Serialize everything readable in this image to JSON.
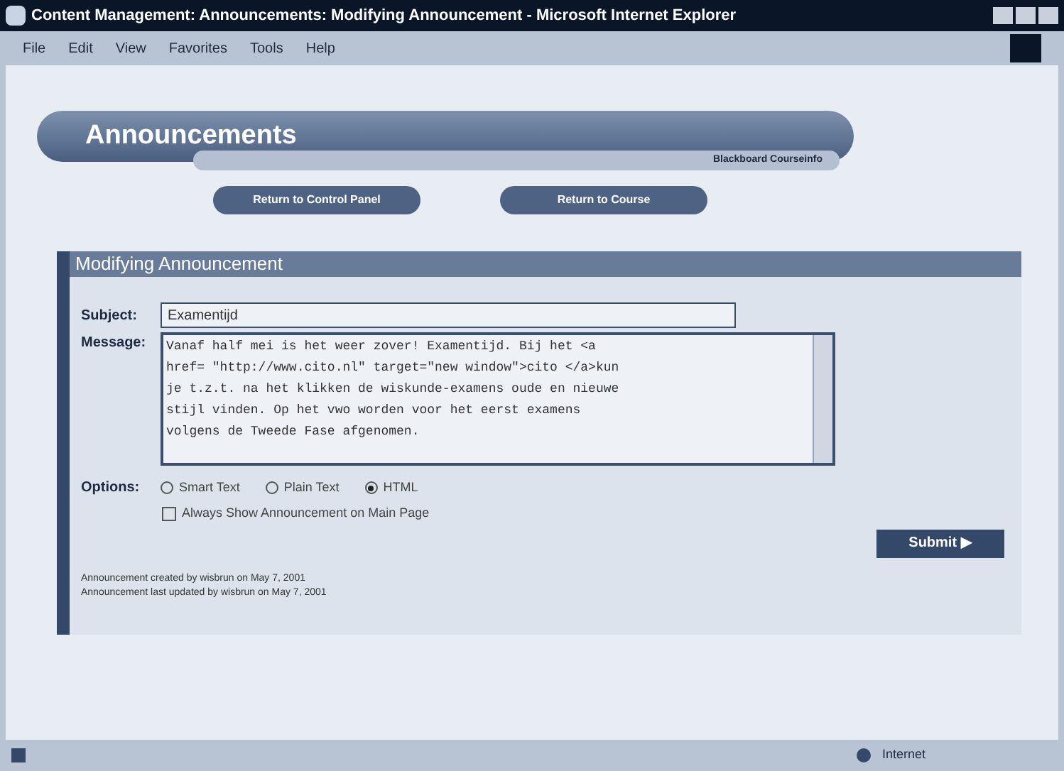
{
  "window": {
    "title": "Content Management: Announcements: Modifying Announcement - Microsoft Internet Explorer"
  },
  "menu": [
    "File",
    "Edit",
    "View",
    "Favorites",
    "Tools",
    "Help"
  ],
  "banner": {
    "title": "Announcements",
    "subtitle": "Blackboard Courseinfo"
  },
  "nav_buttons": [
    "Return to Control Panel",
    "Return to Course"
  ],
  "form": {
    "heading": "Modifying Announcement",
    "subject_label": "Subject:",
    "subject": "Examentijd",
    "message_label": "Message:",
    "message_lines": [
      "Vanaf half mei is het weer zover! Examentijd. Bij het <a",
      "href= \"http://www.cito.nl\" target=\"new window\">cito </a>kun",
      "je t.z.t. na het klikken de wiskunde-examens oude en nieuwe",
      "stijl vinden. Op het vwo worden voor het eerst examens",
      "volgens de Tweede Fase afgenomen."
    ],
    "options_label": "Options:",
    "formats": [
      {
        "label": "Smart Text",
        "selected": false
      },
      {
        "label": "Plain Text",
        "selected": false
      },
      {
        "label": "HTML",
        "selected": true
      }
    ],
    "always_show": {
      "label": "Always Show Announcement on Main Page",
      "checked": false
    },
    "submit": "Submit ▶",
    "footer": [
      "Announcement created by wisbrun on May 7, 2001",
      "Announcement last updated by wisbrun on May 7, 2001"
    ]
  },
  "status_bar": {
    "zone": "Internet"
  }
}
